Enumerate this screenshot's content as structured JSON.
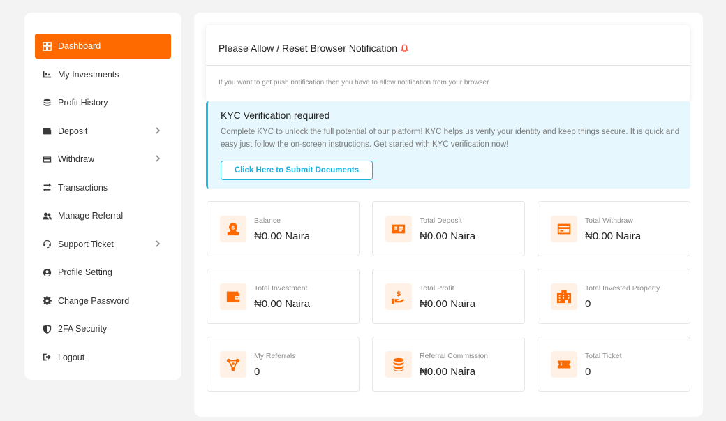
{
  "sidebar": {
    "items": [
      {
        "label": "Dashboard",
        "icon": "dashboard-icon",
        "active": true
      },
      {
        "label": "My Investments",
        "icon": "investments-icon"
      },
      {
        "label": "Profit History",
        "icon": "coins-icon"
      },
      {
        "label": "Deposit",
        "icon": "wallet-icon",
        "has_submenu": true
      },
      {
        "label": "Withdraw",
        "icon": "card-icon",
        "has_submenu": true
      },
      {
        "label": "Transactions",
        "icon": "exchange-icon"
      },
      {
        "label": "Manage Referral",
        "icon": "users-icon"
      },
      {
        "label": "Support Ticket",
        "icon": "headset-icon",
        "has_submenu": true
      },
      {
        "label": "Profile Setting",
        "icon": "user-circle-icon"
      },
      {
        "label": "Change Password",
        "icon": "gear-icon"
      },
      {
        "label": "2FA Security",
        "icon": "shield-icon"
      },
      {
        "label": "Logout",
        "icon": "logout-icon"
      }
    ]
  },
  "notification": {
    "title": "Please Allow / Reset Browser Notification",
    "icon": "bell-icon",
    "text": "If you want to get push notification then you have to allow notification from your browser"
  },
  "kyc": {
    "title": "KYC Verification required",
    "text": "Complete KYC to unlock the full potential of our platform! KYC helps us verify your identity and keep things secure. It is quick and easy just follow the on-screen instructions. Get started with KYC verification now!",
    "button_label": "Click Here to Submit Documents"
  },
  "stats": [
    {
      "label": "Balance",
      "value": "₦0.00 Naira",
      "icon": "balance-icon"
    },
    {
      "label": "Total Deposit",
      "value": "₦0.00 Naira",
      "icon": "deposit-icon"
    },
    {
      "label": "Total Withdraw",
      "value": "₦0.00 Naira",
      "icon": "withdraw-card-icon"
    },
    {
      "label": "Total Investment",
      "value": "₦0.00 Naira",
      "icon": "wallet-icon"
    },
    {
      "label": "Total Profit",
      "value": "₦0.00 Naira",
      "icon": "profit-hand-icon"
    },
    {
      "label": "Total Invested Property",
      "value": "0",
      "icon": "building-icon"
    },
    {
      "label": "My Referrals",
      "value": "0",
      "icon": "network-icon"
    },
    {
      "label": "Referral Commission",
      "value": "₦0.00 Naira",
      "icon": "coin-stack-icon"
    },
    {
      "label": "Total Ticket",
      "value": "0",
      "icon": "ticket-icon"
    }
  ],
  "colors": {
    "accent": "#fe6a00",
    "kyc_border": "#1bbbe8",
    "kyc_bg": "#e6f7fd",
    "icon_bg": "#fff1e6",
    "bell": "#f04d3b"
  }
}
